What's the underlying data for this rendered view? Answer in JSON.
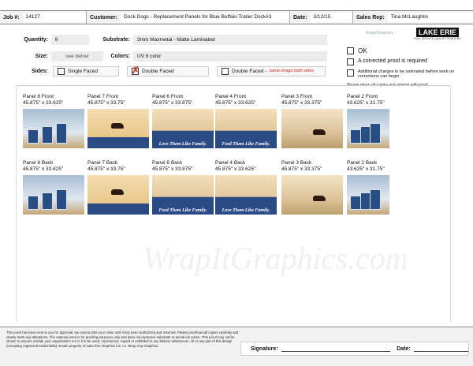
{
  "header": {
    "job_label": "Job #:",
    "job_value": "14127",
    "customer_label": "Customer:",
    "customer_value": "Dock Dogs - Replacement Panels for Blue Buffalo Trailer Dock#3",
    "date_label": "Date:",
    "date_value": "3/12/15",
    "sales_label": "Sales Rep:",
    "sales_value": "Tina McLaughlin"
  },
  "specs": {
    "quantity_label": "Quantity:",
    "quantity_value": "6",
    "substrate_label": "Substrate:",
    "substrate_value": "3mm Maxmetal - Matte Laminated",
    "size_label": "Size:",
    "size_value": "see below",
    "colors_label": "Colors:",
    "colors_value": "UV 6 color",
    "sides_label": "Sides:",
    "single_label": "Single Faced",
    "double_label": "Double Faced",
    "double_same_label": "Double Faced -",
    "double_same_note": "same image both sides",
    "selected_side": "Double Faced"
  },
  "approval": {
    "ok_label": "OK",
    "corrected_label": "A corrected proof is required",
    "charges_label": "Additional charges to be estimated before work on corrections can begin",
    "return_note": "Please return all copies and artwork with proof."
  },
  "logos": {
    "wrapit": "WrapItGraphics",
    "lake_erie": "LAKE ERIE",
    "lake_erie_sub": "FULL SERVICE QUALITY PRINTERS"
  },
  "watermark": "WrapItGraphics.com",
  "panels_front": [
    {
      "title": "Panel 8 Front",
      "size": "45.875\" x 33.625\"",
      "art": "food",
      "tagline": ""
    },
    {
      "title": "Panel 7 Front",
      "size": "45.875\" x 33.75\"",
      "art": "dog",
      "tagline": ""
    },
    {
      "title": "Panel 6 Front",
      "size": "45.875\" x 33.875\"",
      "art": "tag",
      "tagline": "Love Them Like Family."
    },
    {
      "title": "Panel 4 Front",
      "size": "45.875\" x 33.625\"",
      "art": "tag",
      "tagline": "Feed Them Like Family."
    },
    {
      "title": "Panel 3 Front",
      "size": "45.875\" x 33.375\"",
      "art": "beach",
      "tagline": ""
    },
    {
      "title": "Panel 2 Front",
      "size": "43.625\" x 31.75\"",
      "art": "food",
      "tagline": ""
    }
  ],
  "panels_back": [
    {
      "title": "Panel 8 Back",
      "size": "45.875\" x 33.625\"",
      "art": "food",
      "tagline": ""
    },
    {
      "title": "Panel 7 Back",
      "size": "45.875\" x 33.75\"",
      "art": "dog",
      "tagline": ""
    },
    {
      "title": "Panel 6 Back",
      "size": "45.875\" x 33.875\"",
      "art": "tag",
      "tagline": "Feed Them Like Family."
    },
    {
      "title": "Panel 4 Back",
      "size": "45.875\" x 33.625\"",
      "art": "tag",
      "tagline": "Love Them Like Family."
    },
    {
      "title": "Panel 3 Back",
      "size": "45.875\" x 33.375\"",
      "art": "beach",
      "tagline": ""
    },
    {
      "title": "Panel 2 Back",
      "size": "43.625\" x 31.75\"",
      "art": "food",
      "tagline": ""
    }
  ],
  "footer": {
    "disclaimer": "This proof has been sent to you for approval; we cannot print your order until it has been authorized and returned. Please proofread all copies carefully and clearly mark any alterations. The material used is for proofing purposes only and does not represent substrate or actual ink colors. This proof may not be shown to anyone outside your organization nor is it to be used, reproduced, copied or exhibited in any fashion whatsoever. All or any part of this design (excepting registered trademarks) remain property of Lake Erie Graphics Inc. i.e. Wrap it up Graphics.",
    "signature_label": "Signature:",
    "date_label": "Date:"
  },
  "colors": {
    "brand_blue": "#2a4b85",
    "check_red": "#c0392b"
  }
}
